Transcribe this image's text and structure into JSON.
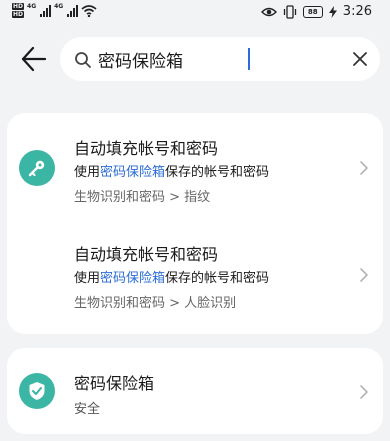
{
  "status_bar": {
    "hd1": "HD",
    "hd2": "HD",
    "net1": "4G",
    "net2": "4G",
    "battery": "88",
    "time": "3:26"
  },
  "search": {
    "query": "密码保险箱"
  },
  "results": [
    {
      "title": "自动填充帐号和密码",
      "desc_prefix": "使用",
      "desc_highlight": "密码保险箱",
      "desc_suffix": "保存的帐号和密码",
      "path": "生物识别和密码 > 指纹",
      "icon": "key-icon"
    },
    {
      "title": "自动填充帐号和密码",
      "desc_prefix": "使用",
      "desc_highlight": "密码保险箱",
      "desc_suffix": "保存的帐号和密码",
      "path": "生物识别和密码 > 人脸识别"
    },
    {
      "title": "密码保险箱",
      "subtitle": "安全",
      "icon": "shield-icon"
    }
  ],
  "colors": {
    "accent": "#2b6cd6",
    "icon_bg": "#3bb5a4",
    "background": "#f1f3f5"
  }
}
